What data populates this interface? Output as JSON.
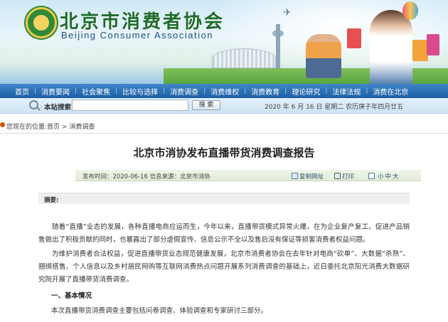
{
  "header": {
    "site_title": "北京市消费者协会",
    "site_subtitle": "Beijing Consumer Association"
  },
  "nav": {
    "items": [
      {
        "label": "首页"
      },
      {
        "label": "消费要闻"
      },
      {
        "label": "社会聚焦"
      },
      {
        "label": "比较与选择"
      },
      {
        "label": "消费调查"
      },
      {
        "label": "消费维权"
      },
      {
        "label": "消费教育"
      },
      {
        "label": "理论研究"
      },
      {
        "label": "法律法规"
      },
      {
        "label": "消费在北京"
      }
    ]
  },
  "search": {
    "label": "本站搜索:",
    "value": "",
    "button_label": "搜 索"
  },
  "date_line": "2020 年 6 月 16 日   星期二   农历庚子年四月廿五",
  "breadcrumb": {
    "prefix": "您现在的位置:",
    "home": "首页",
    "sep": " > ",
    "current": "消费调查"
  },
  "article": {
    "title": "北京市消协发布直播带货消费调查报告",
    "meta": "发布时间：2020-06-16   信息来源：北京市消协",
    "copy_label": "复制网址",
    "print_label": "打印",
    "font_sizes": [
      "小",
      "中",
      "大"
    ],
    "summary_label": "摘要:",
    "paragraphs": [
      "随着“直播”业态的发展，各种直播电商应运而生，今年以来，直播带货模式异常火爆，在为企业复产复工、促进产品销售做出了积极贡献的同时，也暴露出了部分虚假宣传、信息公示不全以及售后没有保证等损害消费者权益问题。",
      "为维护消费者合法权益，促进直播带货业态规范健康发展，北京市消费者协会在去年针对电商“砍单”、大数据“杀熟”、捆绑搭售、个人信息以及乡村居民网购等互联网消费热点问题开展系列消费调查的基础上，近日委托北京阳光消费大数据研究院开展了直播带货消费调查。"
    ],
    "section_heading": "一、基本情况",
    "section_text": "本次直播带货消费调查主要包括问卷调查、体验调查和专家研讨三部分。"
  }
}
